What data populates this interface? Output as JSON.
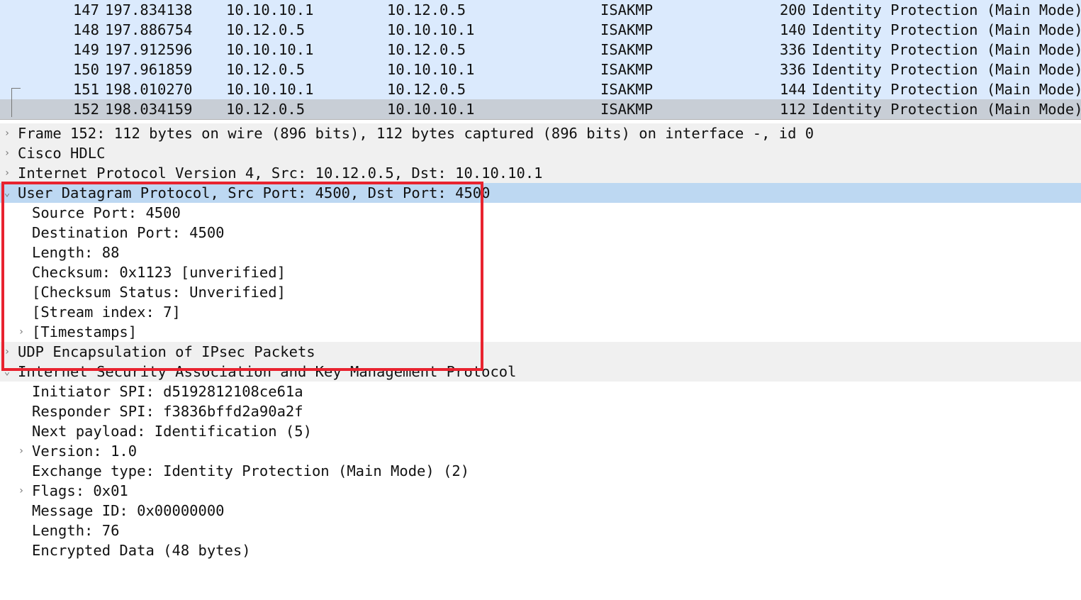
{
  "packet_list": {
    "rows": [
      {
        "no": "147",
        "time": "197.834138",
        "source": "10.10.10.1",
        "destination": "10.12.0.5",
        "protocol": "ISAKMP",
        "length": "200",
        "info": "Identity Protection (Main Mode)"
      },
      {
        "no": "148",
        "time": "197.886754",
        "source": "10.12.0.5",
        "destination": "10.10.10.1",
        "protocol": "ISAKMP",
        "length": "140",
        "info": "Identity Protection (Main Mode)"
      },
      {
        "no": "149",
        "time": "197.912596",
        "source": "10.10.10.1",
        "destination": "10.12.0.5",
        "protocol": "ISAKMP",
        "length": "336",
        "info": "Identity Protection (Main Mode)"
      },
      {
        "no": "150",
        "time": "197.961859",
        "source": "10.12.0.5",
        "destination": "10.10.10.1",
        "protocol": "ISAKMP",
        "length": "336",
        "info": "Identity Protection (Main Mode)"
      },
      {
        "no": "151",
        "time": "198.010270",
        "source": "10.10.10.1",
        "destination": "10.12.0.5",
        "protocol": "ISAKMP",
        "length": "144",
        "info": "Identity Protection (Main Mode)"
      },
      {
        "no": "152",
        "time": "198.034159",
        "source": "10.12.0.5",
        "destination": "10.10.10.1",
        "protocol": "ISAKMP",
        "length": "112",
        "info": "Identity Protection (Main Mode)"
      }
    ]
  },
  "details": {
    "collapsed_arrow": "›",
    "expanded_arrow": "⌄",
    "frame": "Frame 152: 112 bytes on wire (896 bits), 112 bytes captured (896 bits) on interface -, id 0",
    "hdlc": "Cisco HDLC",
    "ipv4": "Internet Protocol Version 4, Src: 10.12.0.5, Dst: 10.10.10.1",
    "udp": {
      "header": "User Datagram Protocol, Src Port: 4500, Dst Port: 4500",
      "fields": [
        "Source Port: 4500",
        "Destination Port: 4500",
        "Length: 88",
        "Checksum: 0x1123 [unverified]",
        "[Checksum Status: Unverified]",
        "[Stream index: 7]"
      ],
      "timestamps": "[Timestamps]"
    },
    "udp_encap": "UDP Encapsulation of IPsec Packets",
    "isakmp": {
      "header": "Internet Security Association and Key Management Protocol",
      "initiator_spi": "Initiator SPI: d5192812108ce61a",
      "responder_spi": "Responder SPI: f3836bffd2a90a2f",
      "next_payload": "Next payload: Identification (5)",
      "version": "Version: 1.0",
      "exchange_type": "Exchange type: Identity Protection (Main Mode) (2)",
      "flags": "Flags: 0x01",
      "message_id": "Message ID: 0x00000000",
      "length": "Length: 76",
      "encrypted_data": "Encrypted Data (48 bytes)"
    }
  },
  "colors": {
    "packet_row_bg": "#dbeafd",
    "selected_packet_bg": "#c8ced6",
    "selected_detail_bg": "#bdd8f2",
    "highlight_box": "#e8232f"
  }
}
